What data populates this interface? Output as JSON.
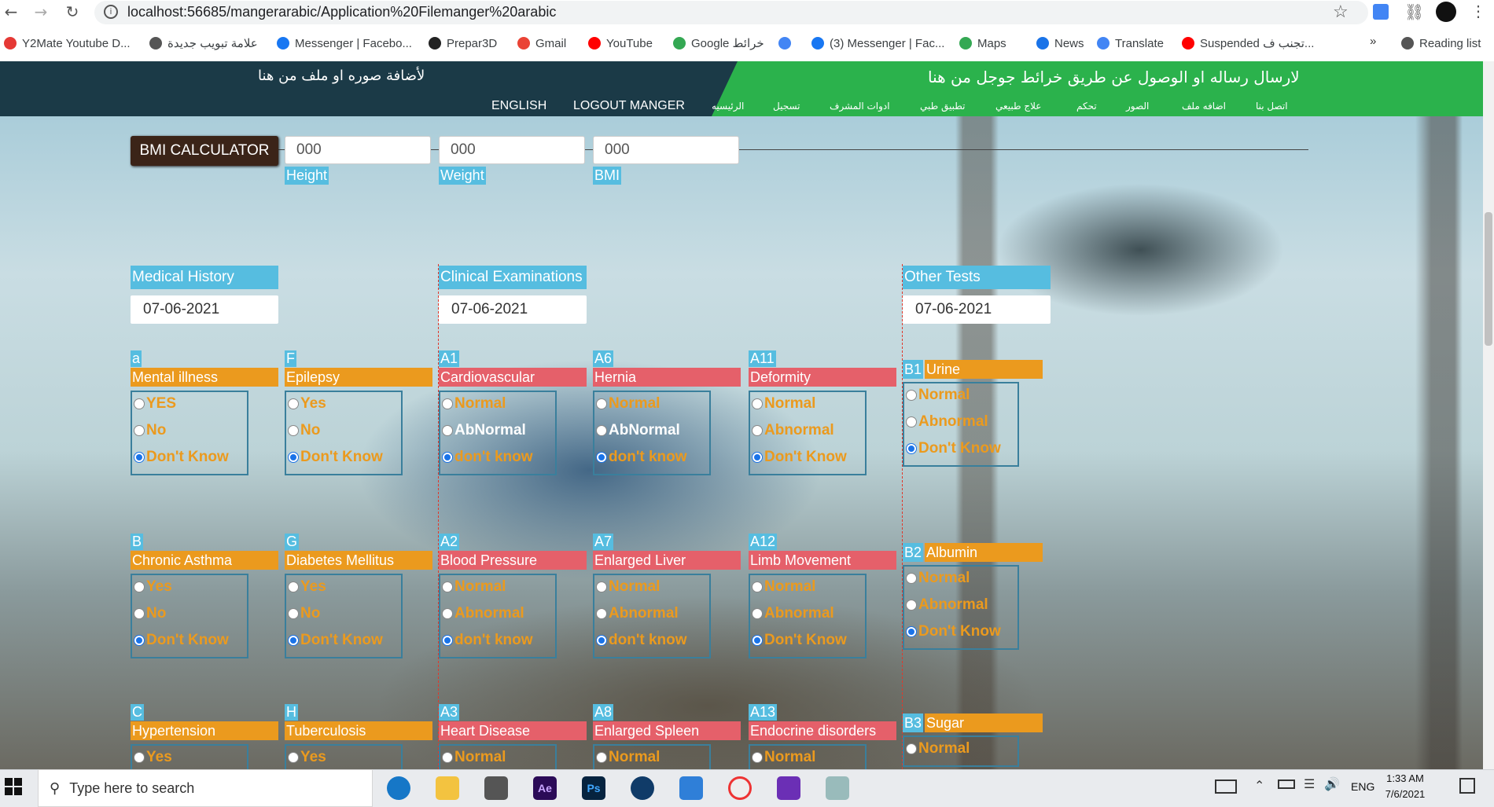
{
  "browser": {
    "url": "localhost:56685/mangerarabic/Application%20Filemanger%20arabic",
    "bookmarks": [
      "Y2Mate Youtube D...",
      "علامة تبويب جديدة",
      "Messenger | Facebo...",
      "Prepar3D",
      "Gmail",
      "YouTube",
      "Google خرائط",
      "",
      "(3) Messenger | Fac...",
      "Maps",
      "News",
      "Translate",
      "Suspended تجنب ف...",
      "Reading list"
    ],
    "bookmark_colors": [
      "#e53935",
      "#555555",
      "#1877f2",
      "#222222",
      "#ea4335",
      "#ff0000",
      "#34a853",
      "#4285f4",
      "#1877f2",
      "#34a853",
      "#1a73e8",
      "#4285f4",
      "#ff0000",
      "#555555"
    ],
    "overflow": "»"
  },
  "header": {
    "green_text": "لارسال رساله او الوصول عن طريق خرائط جوجل من هنا",
    "dark_text": "لأضافة صوره او ملف من هنا",
    "nav_en": [
      "ENGLISH",
      "LOGOUT MANGER"
    ],
    "nav_ar": [
      "الرئيسيه",
      "تسجيل",
      "ادوات المشرف",
      "تطبيق طبي",
      "علاج طبيعي",
      "تحكم",
      "الصور",
      "اضافه ملف",
      "اتصل بنا"
    ],
    "green": "#2bb24c",
    "dark": "#1b3a47"
  },
  "bmi": {
    "button": "BMI CALCULATOR",
    "height_value": "000",
    "weight_value": "000",
    "bmi_value": "000",
    "height_label": "Height",
    "weight_label": "Weight",
    "bmi_label": "BMI"
  },
  "sections": {
    "medical": {
      "title": "Medical History",
      "date": "07-06-2021"
    },
    "clinical": {
      "title": "Clinical Examinations",
      "date": "07-06-2021"
    },
    "other": {
      "title": "Other Tests",
      "date": "07-06-2021"
    }
  },
  "items": [
    {
      "code": "a",
      "name": "Mental illness",
      "color": "orange",
      "options": [
        "YES",
        "No",
        "Don't Know"
      ],
      "selected": 2
    },
    {
      "code": "F",
      "name": "Epilepsy",
      "color": "orange",
      "options": [
        "Yes",
        "No",
        "Don't Know"
      ],
      "selected": 2
    },
    {
      "code": "A1",
      "name": "Cardiovascular",
      "color": "red",
      "options": [
        "Normal",
        "AbNormal",
        "don't know"
      ],
      "selected": 2
    },
    {
      "code": "A6",
      "name": "Hernia",
      "color": "red",
      "options": [
        "Normal",
        "AbNormal",
        "don't know"
      ],
      "selected": 2
    },
    {
      "code": "A11",
      "name": "Deformity",
      "color": "red",
      "options": [
        "Normal",
        "Abnormal",
        "Don't Know"
      ],
      "selected": 2
    },
    {
      "code": "B1",
      "name": "Urine",
      "color": "orange",
      "options": [
        "Normal",
        "Abnormal",
        "Don't Know"
      ],
      "selected": 2
    },
    {
      "code": "B",
      "name": "Chronic Asthma",
      "color": "orange",
      "options": [
        "Yes",
        "No",
        "Don't Know"
      ],
      "selected": 2
    },
    {
      "code": "G",
      "name": "Diabetes Mellitus",
      "color": "orange",
      "options": [
        "Yes",
        "No",
        "Don't Know"
      ],
      "selected": 2
    },
    {
      "code": "A2",
      "name": "Blood Pressure",
      "color": "red",
      "options": [
        "Normal",
        "Abnormal",
        "don't know"
      ],
      "selected": 2
    },
    {
      "code": "A7",
      "name": "Enlarged Liver",
      "color": "red",
      "options": [
        "Normal",
        "Abnormal",
        "don't know"
      ],
      "selected": 2
    },
    {
      "code": "A12",
      "name": "Limb Movement",
      "color": "red",
      "options": [
        "Normal",
        "Abnormal",
        "Don't Know"
      ],
      "selected": 2
    },
    {
      "code": "B2",
      "name": "Albumin",
      "color": "orange",
      "options": [
        "Normal",
        "Abnormal",
        "Don't Know"
      ],
      "selected": 2
    },
    {
      "code": "C",
      "name": "Hypertension",
      "color": "orange",
      "options": [
        "Yes"
      ],
      "selected": -1
    },
    {
      "code": "H",
      "name": "Tuberculosis",
      "color": "orange",
      "options": [
        "Yes"
      ],
      "selected": -1
    },
    {
      "code": "A3",
      "name": "Heart Disease",
      "color": "red",
      "options": [
        "Normal"
      ],
      "selected": -1
    },
    {
      "code": "A8",
      "name": "Enlarged Spleen",
      "color": "red",
      "options": [
        "Normal"
      ],
      "selected": -1
    },
    {
      "code": "A13",
      "name": "Endocrine disorders",
      "color": "red",
      "options": [
        "Normal"
      ],
      "selected": -1
    },
    {
      "code": "B3",
      "name": "Sugar",
      "color": "orange",
      "options": [
        "Normal"
      ],
      "selected": -1
    }
  ],
  "taskbar": {
    "search_placeholder": "Type here to search",
    "time": "1:33 AM",
    "date": "7/6/2021",
    "lang": "ENG"
  }
}
